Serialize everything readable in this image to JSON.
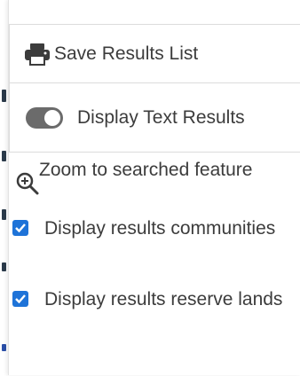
{
  "panel": {
    "save_label": "Save Results List",
    "display_text_label": "Display Text Results",
    "zoom_label": "Zoom to searched feature",
    "checkbox_items": [
      {
        "label": "Display results communities",
        "checked": true
      },
      {
        "label": "Display results reserve lands",
        "checked": true
      }
    ]
  },
  "icons": {
    "save": "printer-icon",
    "toggle": "toggle-switch",
    "zoom": "zoom-plus-icon",
    "checkbox": "checkbox-checked-icon"
  },
  "colors": {
    "text": "#3c3c3c",
    "toggle": "#6b6b6b",
    "checkbox": "#1e73d8",
    "border": "#dcdcdc"
  }
}
